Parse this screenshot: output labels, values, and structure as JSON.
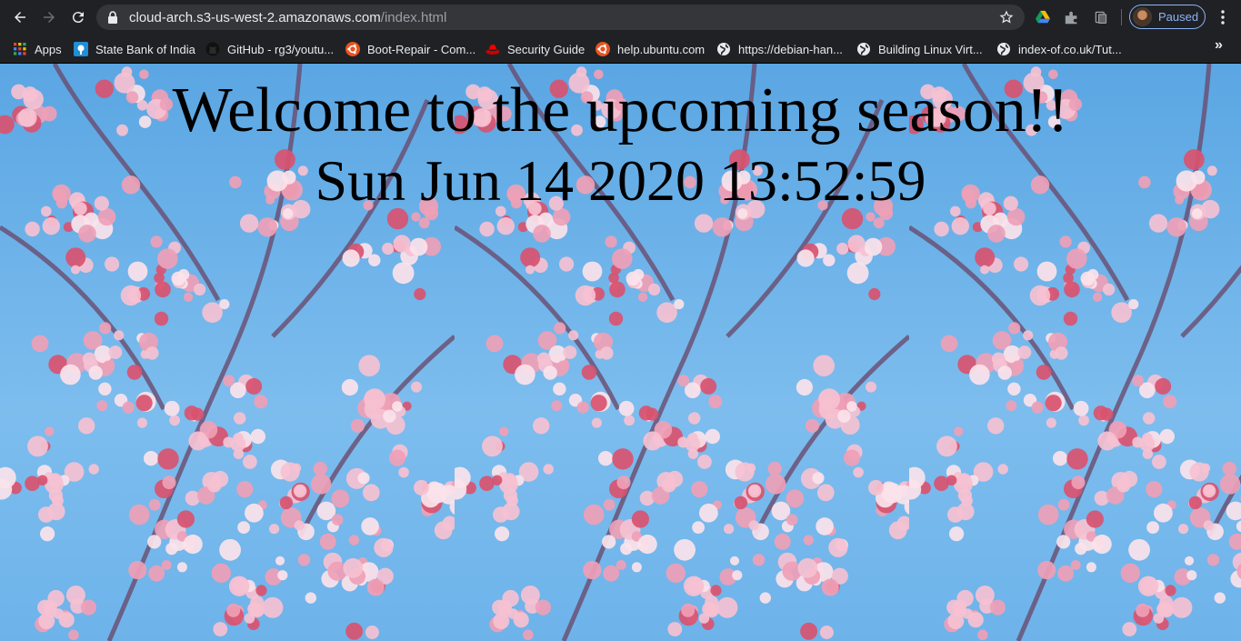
{
  "browser": {
    "url_host": "cloud-arch.s3-us-west-2.amazonaws.com",
    "url_path": "/index.html",
    "profile_status": "Paused",
    "bookmarks": [
      {
        "label": "Apps",
        "icon": "apps-grid-icon"
      },
      {
        "label": "State Bank of India",
        "icon": "sbi-icon"
      },
      {
        "label": "GitHub - rg3/youtu...",
        "icon": "github-icon"
      },
      {
        "label": "Boot-Repair - Com...",
        "icon": "ubuntu-icon"
      },
      {
        "label": "Security Guide",
        "icon": "redhat-icon"
      },
      {
        "label": "help.ubuntu.com",
        "icon": "ubuntu-icon"
      },
      {
        "label": "https://debian-han...",
        "icon": "globe-icon"
      },
      {
        "label": "Building Linux Virt...",
        "icon": "globe-icon"
      },
      {
        "label": "index-of.co.uk/Tut...",
        "icon": "globe-icon"
      }
    ],
    "more_bookmarks": "»"
  },
  "page": {
    "heading": "Welcome to the upcoming season!!",
    "clock": "Sun Jun 14 2020 13:52:59",
    "background_image": "cherry-blossom-tile"
  },
  "colors": {
    "chrome_bg": "#202124",
    "omnibox_bg": "#35363a",
    "accent": "#8ab4f8",
    "sky": "#6fb2e6",
    "blossom": "#f4b9cc"
  }
}
